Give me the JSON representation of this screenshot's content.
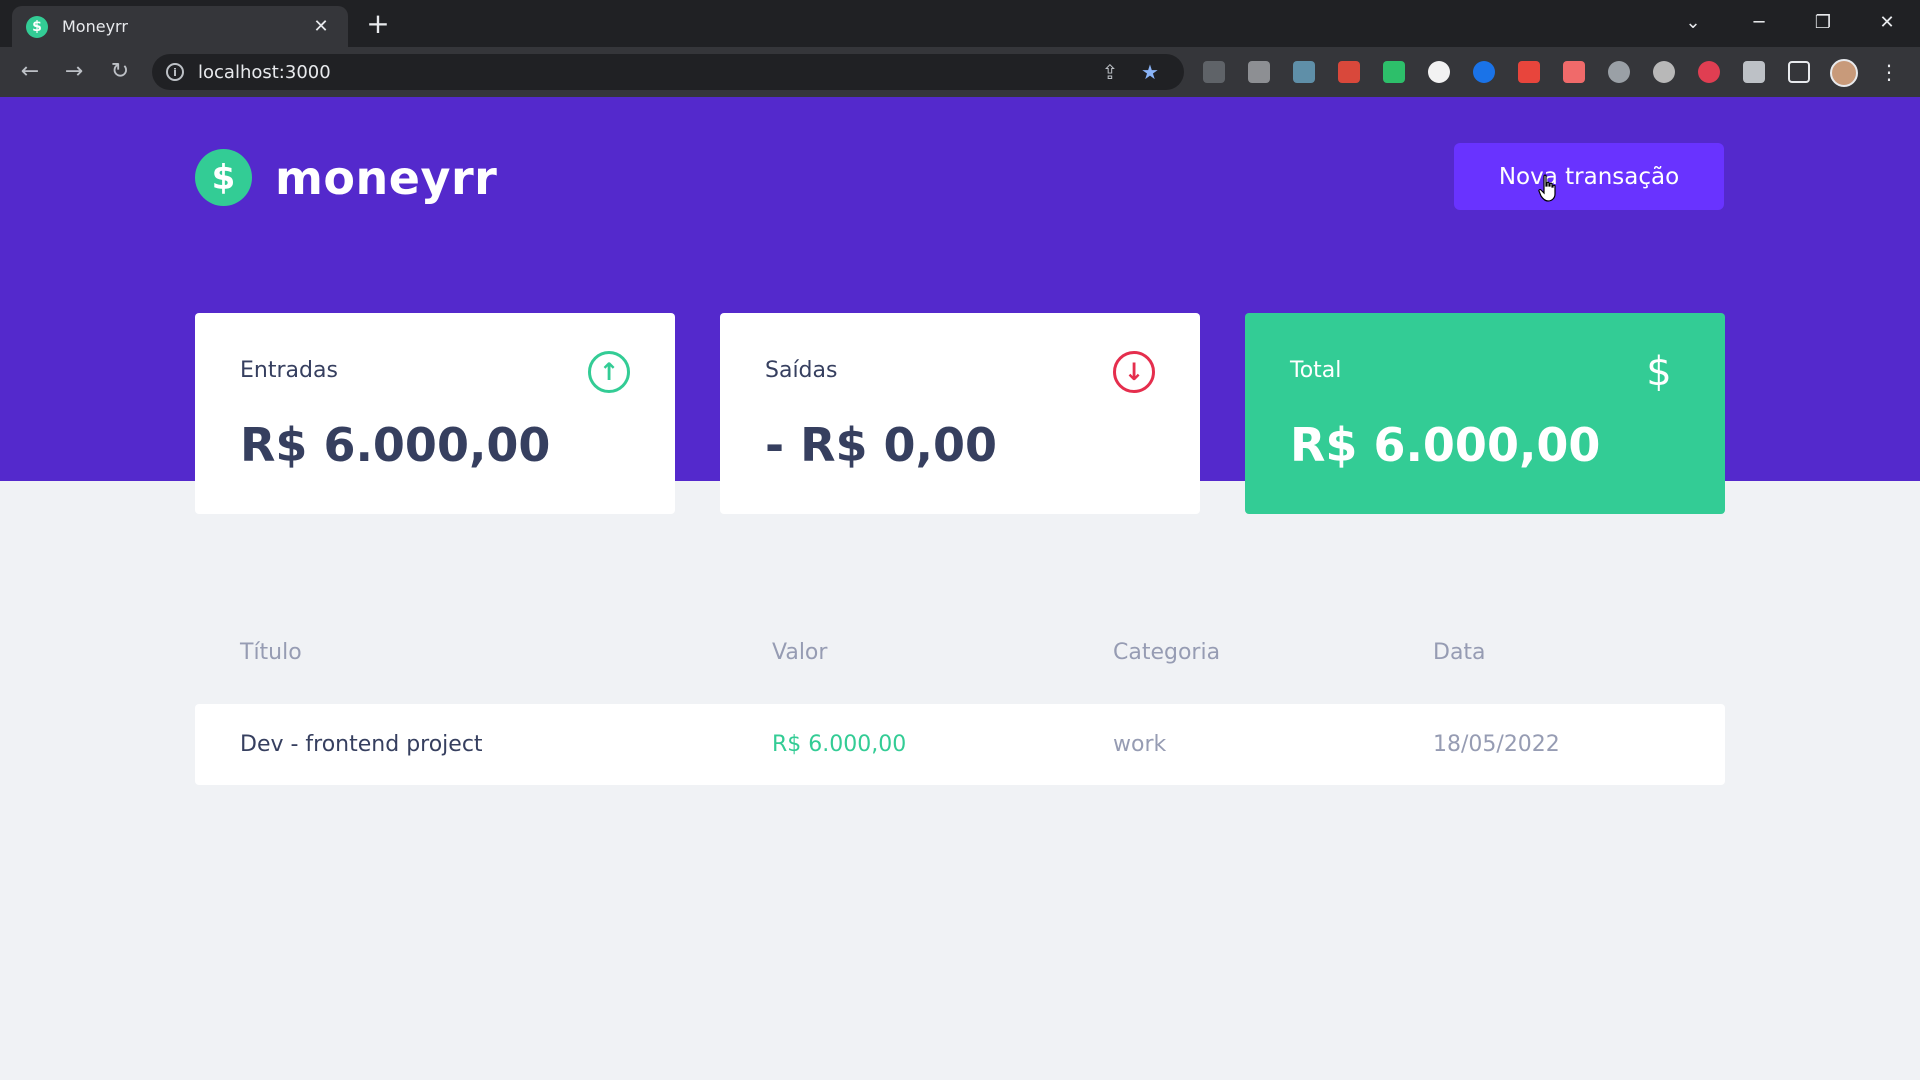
{
  "browser": {
    "tab_title": "Moneyrr",
    "tab_favicon": "$",
    "close_glyph": "✕",
    "new_tab_glyph": "+",
    "url": "localhost:3000",
    "win_controls": {
      "dropdown": "⌄",
      "minimize": "─",
      "restore": "❐",
      "close": "✕"
    },
    "nav": {
      "back": "←",
      "forward": "→",
      "reload": "↻"
    },
    "info_glyph": "i",
    "share_glyph": "⇪",
    "star_glyph": "★",
    "menu_glyph": "⋮"
  },
  "app": {
    "logo_symbol": "$",
    "brand": "moneyrr",
    "new_transaction_label": "Nova transação",
    "colors": {
      "hero": "#5429cc",
      "green": "#33cc95",
      "red": "#e52e4d",
      "button": "#6933ff"
    }
  },
  "summary": {
    "income": {
      "label": "Entradas",
      "value": "R$ 6.000,00",
      "icon": "arrow-up-circle",
      "glyph": "↑"
    },
    "outcome": {
      "label": "Saídas",
      "value": "- R$ 0,00",
      "icon": "arrow-down-circle",
      "glyph": "↓"
    },
    "total": {
      "label": "Total",
      "value": "R$ 6.000,00",
      "icon": "dollar",
      "glyph": "$"
    }
  },
  "table": {
    "headers": [
      "Título",
      "Valor",
      "Categoria",
      "Data"
    ],
    "rows": [
      {
        "title": "Dev - frontend project",
        "amount": "R$ 6.000,00",
        "category": "work",
        "date": "18/05/2022"
      }
    ]
  }
}
